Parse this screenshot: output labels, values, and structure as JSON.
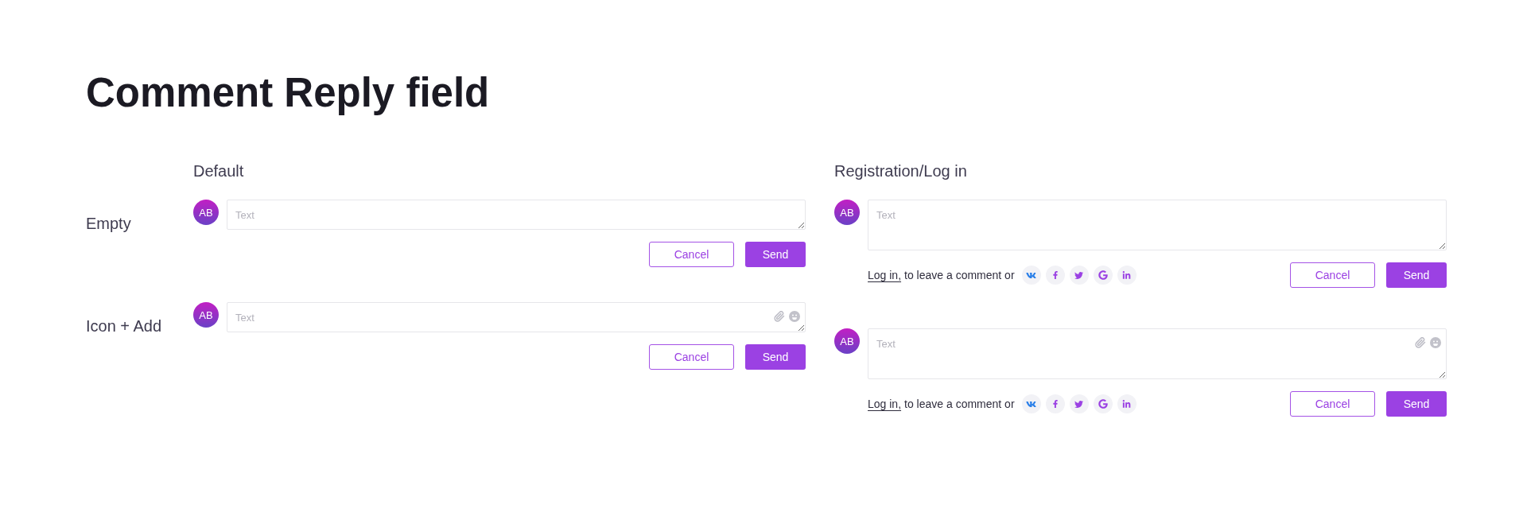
{
  "title": "Comment Reply field",
  "sections": [
    {
      "heading": "Default",
      "kind": "default",
      "items": [
        {
          "row_label": "Empty",
          "avatar": "AB",
          "placeholder": "Text",
          "attach_icons": false,
          "cancel": "Cancel",
          "send": "Send"
        },
        {
          "row_label": "Icon + Add",
          "avatar": "AB",
          "placeholder": "Text",
          "attach_icons": true,
          "cancel": "Cancel",
          "send": "Send"
        }
      ]
    },
    {
      "heading": "Registration/Log in",
      "kind": "login",
      "items": [
        {
          "avatar": "AB",
          "placeholder": "Text",
          "attach_icons": false,
          "login_link": "Log in,",
          "login_text": "to leave a comment or",
          "cancel": "Cancel",
          "send": "Send"
        },
        {
          "avatar": "AB",
          "placeholder": "Text",
          "attach_icons": true,
          "login_link": "Log in,",
          "login_text": "to leave a comment or",
          "cancel": "Cancel",
          "send": "Send"
        }
      ]
    }
  ]
}
